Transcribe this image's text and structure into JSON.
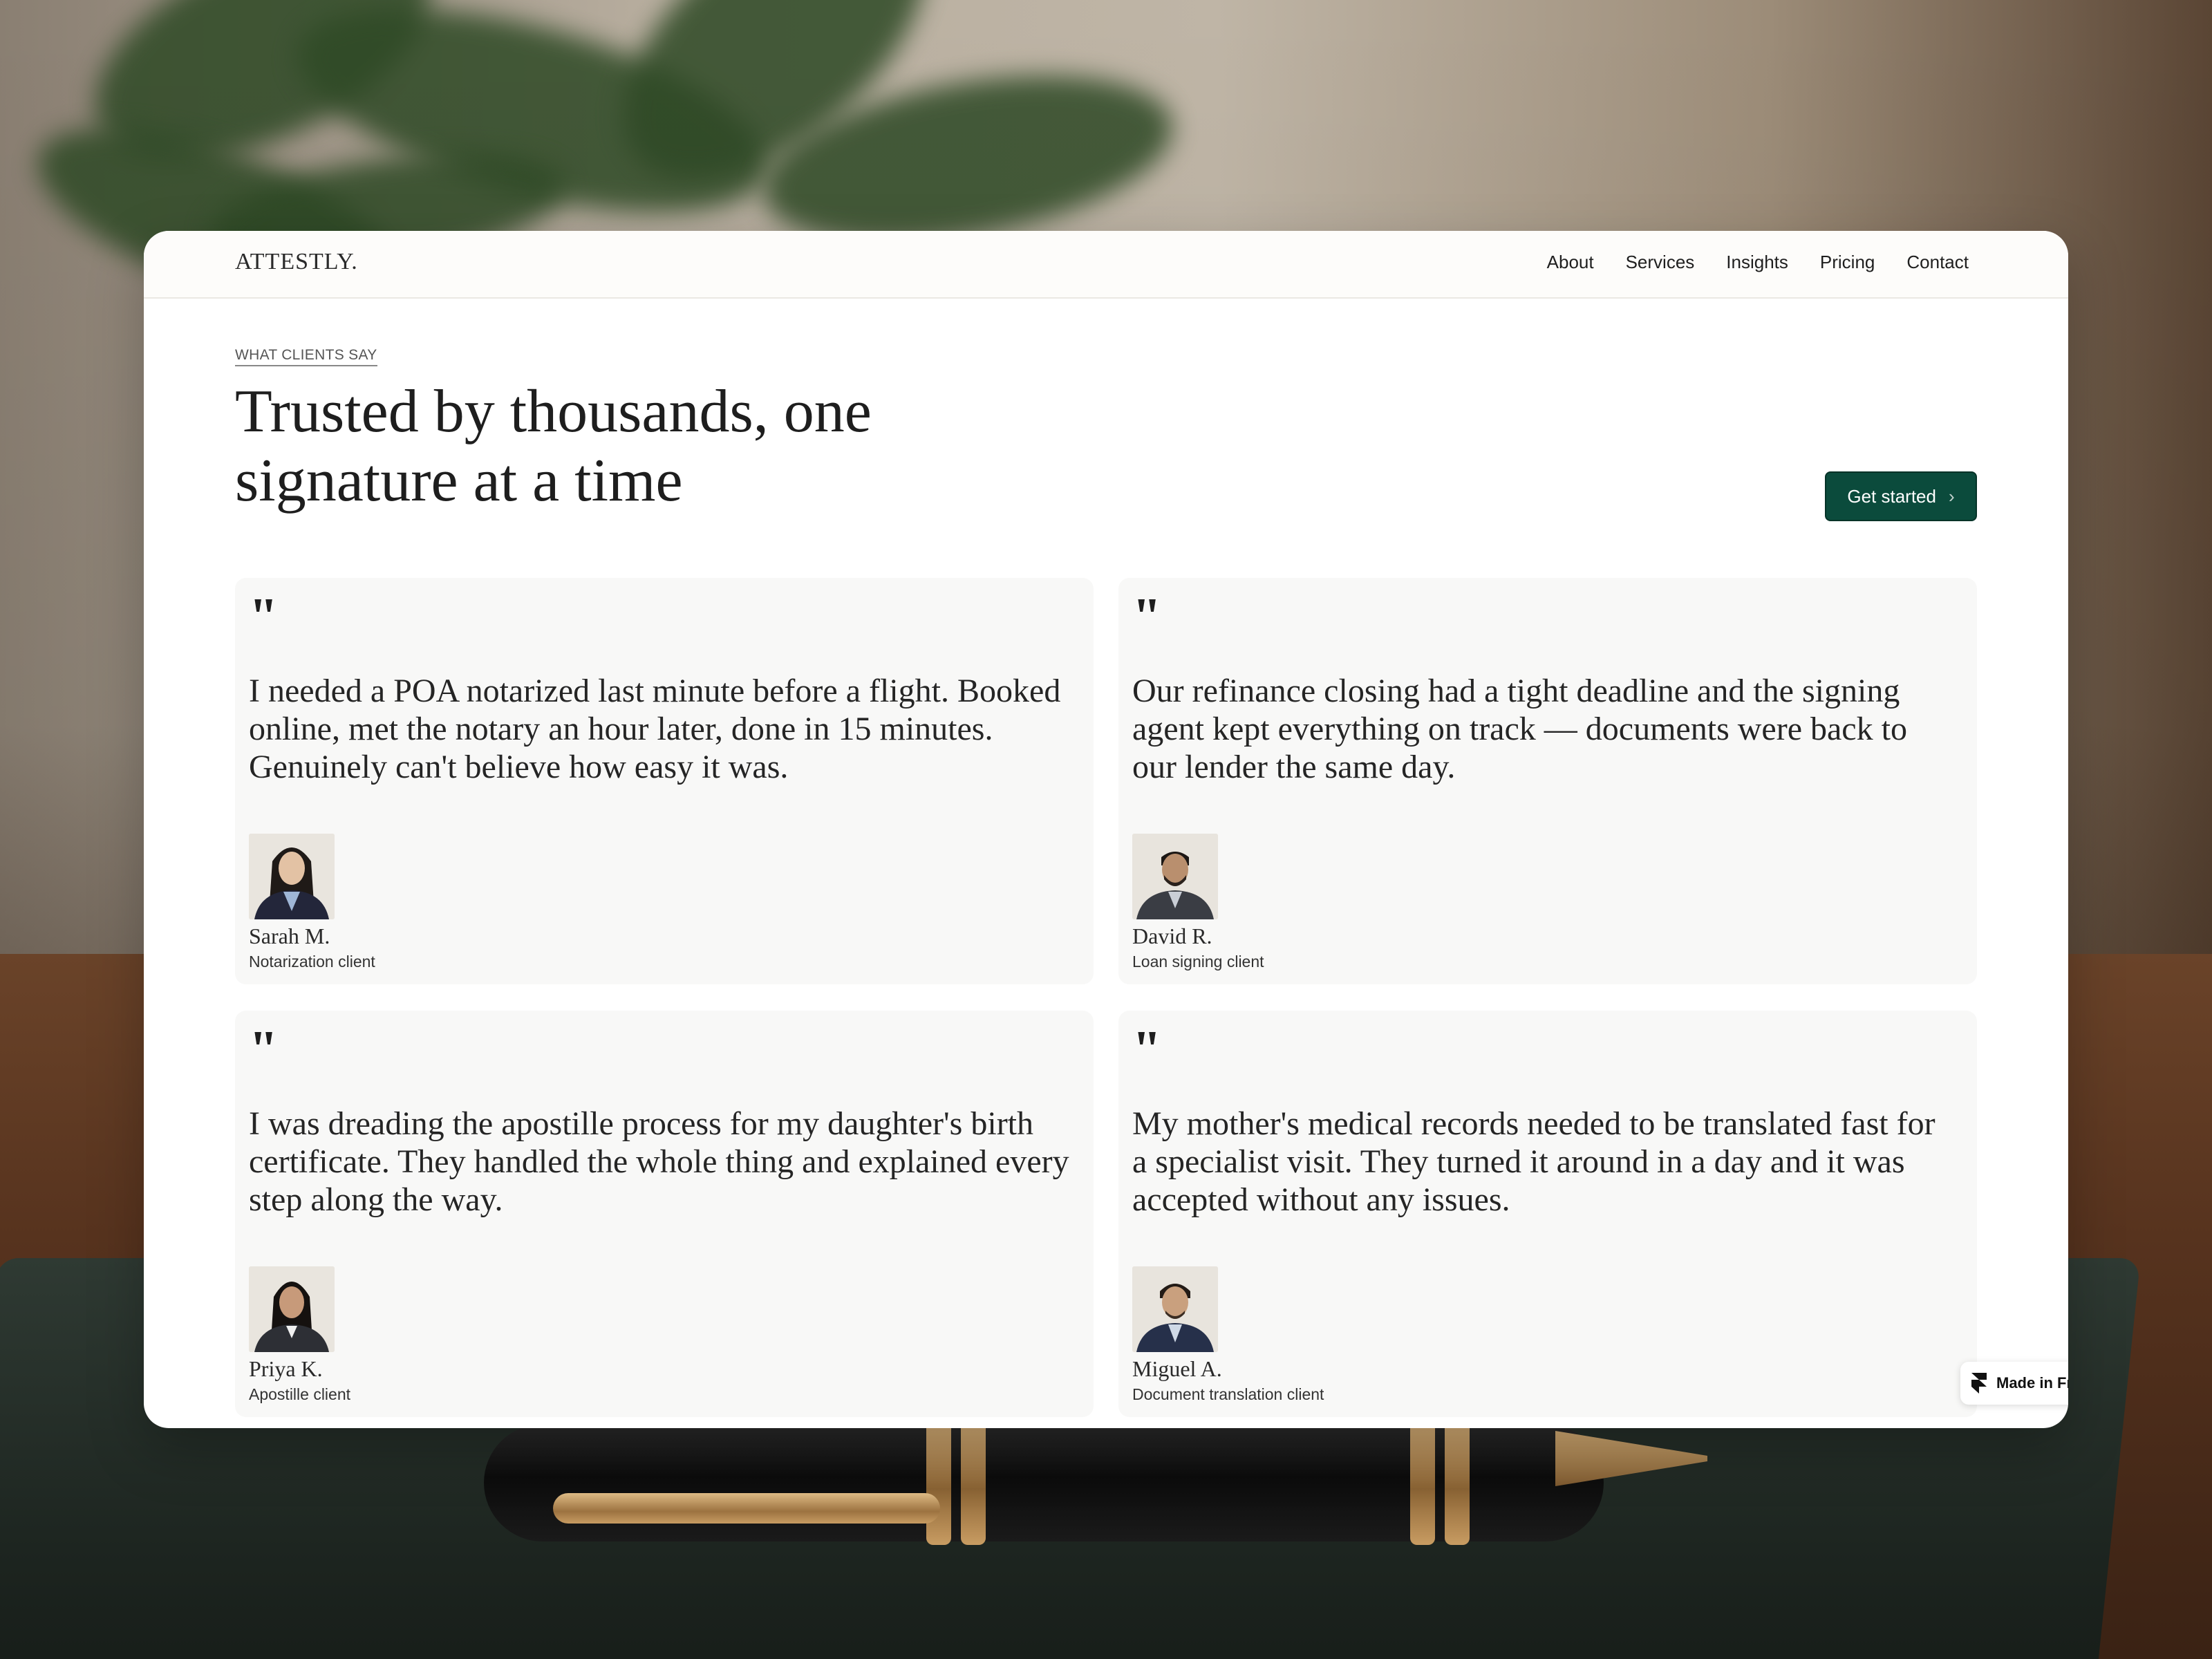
{
  "brand": {
    "name": "ATTESTLY."
  },
  "nav": {
    "items": [
      {
        "label": "About"
      },
      {
        "label": "Services"
      },
      {
        "label": "Insights"
      },
      {
        "label": "Pricing"
      },
      {
        "label": "Contact"
      }
    ]
  },
  "hero": {
    "eyebrow": "WHAT CLIENTS SAY",
    "title_line1": "Trusted by thousands, one",
    "title_line2": "signature at a time",
    "cta_label": "Get started",
    "cta_icon": "chevron-right-icon"
  },
  "testimonials": [
    {
      "quote_mark": "\"",
      "text": "I needed a POA notarized last minute before a flight. Booked online, met the notary an hour later, done in 15 minutes. Genuinely can't believe how easy it was.",
      "name": "Sarah M.",
      "role": "Notarization client"
    },
    {
      "quote_mark": "\"",
      "text": "Our refinance closing had a tight deadline and the signing agent kept everything on track — documents were back to our lender the same day.",
      "name": "David R.",
      "role": "Loan signing client"
    },
    {
      "quote_mark": "\"",
      "text": "I was dreading the apostille process for my daughter's birth certificate. They handled the whole thing and explained every step along the way.",
      "name": "Priya K.",
      "role": "Apostille client"
    },
    {
      "quote_mark": "\"",
      "text": "My mother's medical records needed to be translated fast for a specialist visit. They turned it around in a day and it was accepted without any issues.",
      "name": "Miguel A.",
      "role": "Document translation client"
    }
  ],
  "badge": {
    "label": "Made in Fr",
    "icon": "framer-logo-icon"
  },
  "colors": {
    "accent": "#0b4b3c",
    "card_bg": "#f8f8f7",
    "page_bg": "#ffffff",
    "text": "#1e1e1e"
  }
}
